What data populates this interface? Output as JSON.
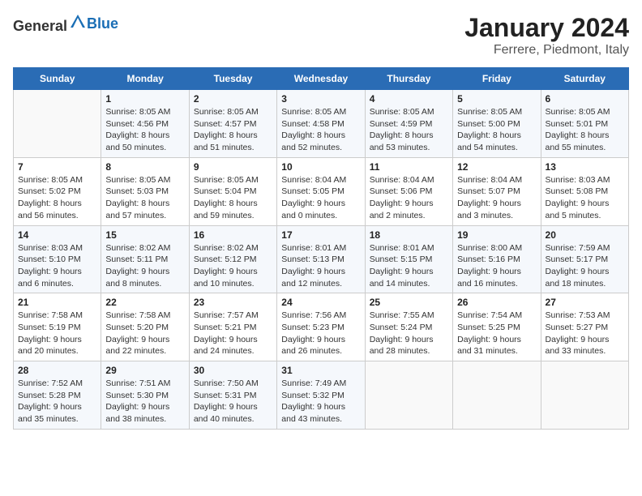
{
  "header": {
    "logo_general": "General",
    "logo_blue": "Blue",
    "month_title": "January 2024",
    "location": "Ferrere, Piedmont, Italy"
  },
  "days_header": [
    "Sunday",
    "Monday",
    "Tuesday",
    "Wednesday",
    "Thursday",
    "Friday",
    "Saturday"
  ],
  "weeks": [
    [
      {
        "day": "",
        "sunrise": "",
        "sunset": "",
        "daylight": ""
      },
      {
        "day": "1",
        "sunrise": "Sunrise: 8:05 AM",
        "sunset": "Sunset: 4:56 PM",
        "daylight": "Daylight: 8 hours and 50 minutes."
      },
      {
        "day": "2",
        "sunrise": "Sunrise: 8:05 AM",
        "sunset": "Sunset: 4:57 PM",
        "daylight": "Daylight: 8 hours and 51 minutes."
      },
      {
        "day": "3",
        "sunrise": "Sunrise: 8:05 AM",
        "sunset": "Sunset: 4:58 PM",
        "daylight": "Daylight: 8 hours and 52 minutes."
      },
      {
        "day": "4",
        "sunrise": "Sunrise: 8:05 AM",
        "sunset": "Sunset: 4:59 PM",
        "daylight": "Daylight: 8 hours and 53 minutes."
      },
      {
        "day": "5",
        "sunrise": "Sunrise: 8:05 AM",
        "sunset": "Sunset: 5:00 PM",
        "daylight": "Daylight: 8 hours and 54 minutes."
      },
      {
        "day": "6",
        "sunrise": "Sunrise: 8:05 AM",
        "sunset": "Sunset: 5:01 PM",
        "daylight": "Daylight: 8 hours and 55 minutes."
      }
    ],
    [
      {
        "day": "7",
        "sunrise": "Sunrise: 8:05 AM",
        "sunset": "Sunset: 5:02 PM",
        "daylight": "Daylight: 8 hours and 56 minutes."
      },
      {
        "day": "8",
        "sunrise": "Sunrise: 8:05 AM",
        "sunset": "Sunset: 5:03 PM",
        "daylight": "Daylight: 8 hours and 57 minutes."
      },
      {
        "day": "9",
        "sunrise": "Sunrise: 8:05 AM",
        "sunset": "Sunset: 5:04 PM",
        "daylight": "Daylight: 8 hours and 59 minutes."
      },
      {
        "day": "10",
        "sunrise": "Sunrise: 8:04 AM",
        "sunset": "Sunset: 5:05 PM",
        "daylight": "Daylight: 9 hours and 0 minutes."
      },
      {
        "day": "11",
        "sunrise": "Sunrise: 8:04 AM",
        "sunset": "Sunset: 5:06 PM",
        "daylight": "Daylight: 9 hours and 2 minutes."
      },
      {
        "day": "12",
        "sunrise": "Sunrise: 8:04 AM",
        "sunset": "Sunset: 5:07 PM",
        "daylight": "Daylight: 9 hours and 3 minutes."
      },
      {
        "day": "13",
        "sunrise": "Sunrise: 8:03 AM",
        "sunset": "Sunset: 5:08 PM",
        "daylight": "Daylight: 9 hours and 5 minutes."
      }
    ],
    [
      {
        "day": "14",
        "sunrise": "Sunrise: 8:03 AM",
        "sunset": "Sunset: 5:10 PM",
        "daylight": "Daylight: 9 hours and 6 minutes."
      },
      {
        "day": "15",
        "sunrise": "Sunrise: 8:02 AM",
        "sunset": "Sunset: 5:11 PM",
        "daylight": "Daylight: 9 hours and 8 minutes."
      },
      {
        "day": "16",
        "sunrise": "Sunrise: 8:02 AM",
        "sunset": "Sunset: 5:12 PM",
        "daylight": "Daylight: 9 hours and 10 minutes."
      },
      {
        "day": "17",
        "sunrise": "Sunrise: 8:01 AM",
        "sunset": "Sunset: 5:13 PM",
        "daylight": "Daylight: 9 hours and 12 minutes."
      },
      {
        "day": "18",
        "sunrise": "Sunrise: 8:01 AM",
        "sunset": "Sunset: 5:15 PM",
        "daylight": "Daylight: 9 hours and 14 minutes."
      },
      {
        "day": "19",
        "sunrise": "Sunrise: 8:00 AM",
        "sunset": "Sunset: 5:16 PM",
        "daylight": "Daylight: 9 hours and 16 minutes."
      },
      {
        "day": "20",
        "sunrise": "Sunrise: 7:59 AM",
        "sunset": "Sunset: 5:17 PM",
        "daylight": "Daylight: 9 hours and 18 minutes."
      }
    ],
    [
      {
        "day": "21",
        "sunrise": "Sunrise: 7:58 AM",
        "sunset": "Sunset: 5:19 PM",
        "daylight": "Daylight: 9 hours and 20 minutes."
      },
      {
        "day": "22",
        "sunrise": "Sunrise: 7:58 AM",
        "sunset": "Sunset: 5:20 PM",
        "daylight": "Daylight: 9 hours and 22 minutes."
      },
      {
        "day": "23",
        "sunrise": "Sunrise: 7:57 AM",
        "sunset": "Sunset: 5:21 PM",
        "daylight": "Daylight: 9 hours and 24 minutes."
      },
      {
        "day": "24",
        "sunrise": "Sunrise: 7:56 AM",
        "sunset": "Sunset: 5:23 PM",
        "daylight": "Daylight: 9 hours and 26 minutes."
      },
      {
        "day": "25",
        "sunrise": "Sunrise: 7:55 AM",
        "sunset": "Sunset: 5:24 PM",
        "daylight": "Daylight: 9 hours and 28 minutes."
      },
      {
        "day": "26",
        "sunrise": "Sunrise: 7:54 AM",
        "sunset": "Sunset: 5:25 PM",
        "daylight": "Daylight: 9 hours and 31 minutes."
      },
      {
        "day": "27",
        "sunrise": "Sunrise: 7:53 AM",
        "sunset": "Sunset: 5:27 PM",
        "daylight": "Daylight: 9 hours and 33 minutes."
      }
    ],
    [
      {
        "day": "28",
        "sunrise": "Sunrise: 7:52 AM",
        "sunset": "Sunset: 5:28 PM",
        "daylight": "Daylight: 9 hours and 35 minutes."
      },
      {
        "day": "29",
        "sunrise": "Sunrise: 7:51 AM",
        "sunset": "Sunset: 5:30 PM",
        "daylight": "Daylight: 9 hours and 38 minutes."
      },
      {
        "day": "30",
        "sunrise": "Sunrise: 7:50 AM",
        "sunset": "Sunset: 5:31 PM",
        "daylight": "Daylight: 9 hours and 40 minutes."
      },
      {
        "day": "31",
        "sunrise": "Sunrise: 7:49 AM",
        "sunset": "Sunset: 5:32 PM",
        "daylight": "Daylight: 9 hours and 43 minutes."
      },
      {
        "day": "",
        "sunrise": "",
        "sunset": "",
        "daylight": ""
      },
      {
        "day": "",
        "sunrise": "",
        "sunset": "",
        "daylight": ""
      },
      {
        "day": "",
        "sunrise": "",
        "sunset": "",
        "daylight": ""
      }
    ]
  ]
}
